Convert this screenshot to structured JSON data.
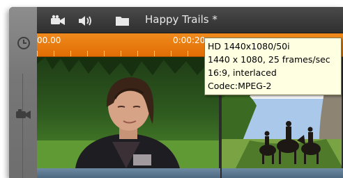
{
  "toolbar": {
    "project_title": "Happy Trails *",
    "icons": [
      "film-camera-icon",
      "speaker-icon",
      "folder-icon"
    ]
  },
  "rail": {
    "icons": [
      "clock-icon",
      "video-camera-icon"
    ]
  },
  "ruler": {
    "ticks": [
      "00.00",
      "0:00:20"
    ],
    "color": "#e97a10"
  },
  "tooltip": {
    "lines": [
      "HD 1440x1080/50i",
      "1440 x 1080, 25 frames/sec",
      "16:9, interlaced",
      "Codec:MPEG-2"
    ]
  },
  "timeline": {
    "clips": [
      "woman-portrait-clip",
      "horse-riders-clip"
    ]
  }
}
